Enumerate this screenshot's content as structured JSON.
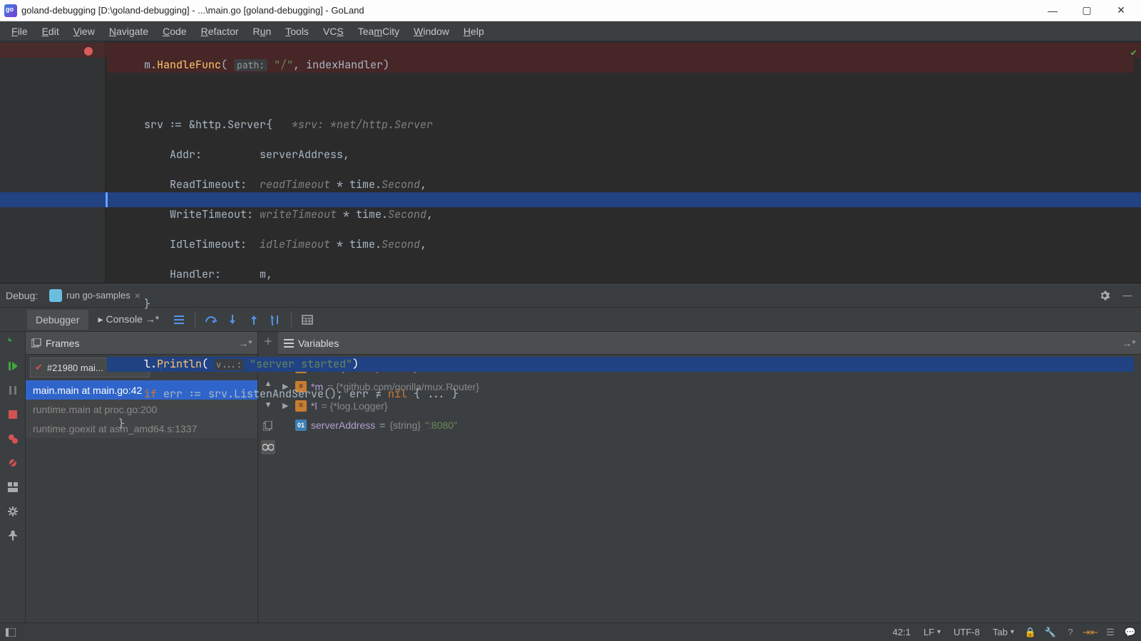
{
  "window": {
    "title": "goland-debugging [D:\\goland-debugging] - ...\\main.go [goland-debugging] - GoLand"
  },
  "menubar": {
    "items": [
      "File",
      "Edit",
      "View",
      "Navigate",
      "Code",
      "Refactor",
      "Run",
      "Tools",
      "VCS",
      "TeamCity",
      "Window",
      "Help"
    ]
  },
  "editor": {
    "lines": {
      "l1_pre": "    m.",
      "l1_fn": "HandleFunc",
      "l1_open": "( ",
      "l1_hint": "path:",
      "l1_str": " \"/\"",
      "l1_rest": ", indexHandler)",
      "l3_pre": "    srv := &http.",
      "l3_type": "Server",
      "l3_brace": "{   ",
      "l3_cmt": "*srv: *net/http.Server",
      "l4_key": "        Addr:",
      "l4_val": "         serverAddress,",
      "l5_key": "        ReadTimeout:",
      "l5_ital": "  readTimeout",
      "l5_rest": " * time.",
      "l5_unit": "Second",
      "l5_comma": ",",
      "l6_key": "        WriteTimeout:",
      "l6_ital": " writeTimeout",
      "l6_rest": " * time.",
      "l6_unit": "Second",
      "l6_comma": ",",
      "l7_key": "        IdleTimeout:",
      "l7_ital": "  idleTimeout",
      "l7_rest": " * time.",
      "l7_unit": "Second",
      "l7_comma": ",",
      "l8_key": "        Handler:",
      "l8_val": "      m,",
      "l9": "    }",
      "l11_pre": "    l.",
      "l11_fn": "Println",
      "l11_open": "( ",
      "l11_hint": "v...:",
      "l11_str": " \"server started\"",
      "l11_close": ")",
      "l12_if": "    if ",
      "l12_mid": "err := srv.ListenAndServe(); err ≠ ",
      "l12_nil": "nil",
      "l12_end": " { ... }",
      "l13": "}"
    }
  },
  "debug": {
    "label": "Debug:",
    "runconf": "run go-samples",
    "tabs": {
      "debugger": "Debugger",
      "console": "Console"
    },
    "frames_title": "Frames",
    "variables_title": "Variables",
    "thread": "#21980 mai...",
    "frames": [
      "main.main at main.go:42",
      "runtime.main at proc.go:200",
      "runtime.goexit at asm_amd64.s:1337"
    ],
    "vars": {
      "srv_name": "*srv",
      "srv_val": " = {*net/http.Server}",
      "m_name": "*m",
      "m_val": " = {*github.com/gorilla/mux.Router}",
      "l_name": "*l",
      "l_val": " = {*log.Logger}",
      "sa_name": "serverAddress",
      "sa_eq": " = ",
      "sa_type": "{string} ",
      "sa_str": "\":8080\""
    }
  },
  "statusbar": {
    "pos": "42:1",
    "le": "LF",
    "enc": "UTF-8",
    "indent": "Tab"
  }
}
